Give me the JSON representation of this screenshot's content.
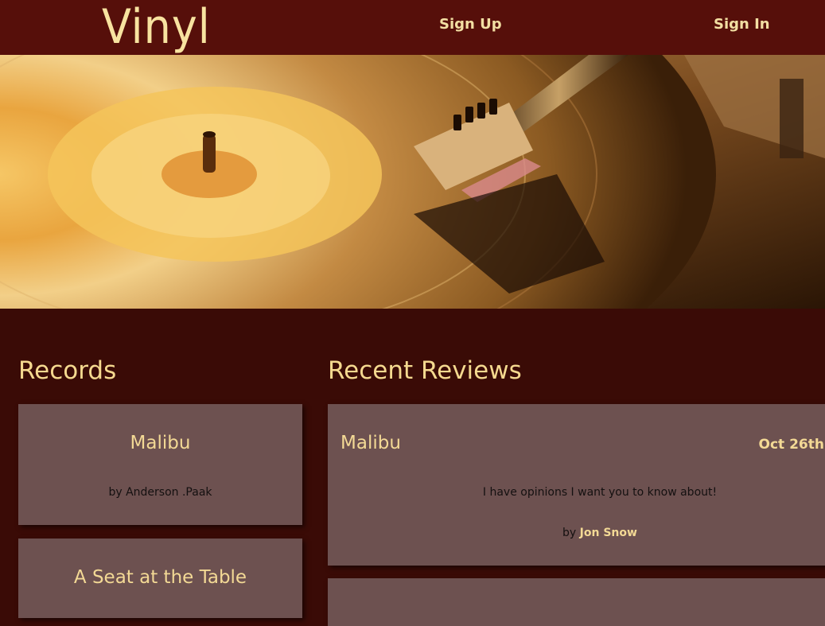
{
  "nav": {
    "logo": "Vinyl",
    "signup": "Sign Up",
    "signin": "Sign In"
  },
  "sections": {
    "records": "Records",
    "reviews": "Recent Reviews"
  },
  "records": [
    {
      "title": "Malibu",
      "artist": "by Anderson .Paak"
    },
    {
      "title": "A Seat at the Table",
      "artist": ""
    }
  ],
  "reviews": [
    {
      "title": "Malibu",
      "date": "Oct 26th",
      "body": "I have opinions I want you to know about!",
      "by": "by",
      "author": "Jon Snow"
    }
  ],
  "colors": {
    "navbar": "#560f0a",
    "background": "#3a0b06",
    "card": "#6d5150",
    "accent": "#f3d995"
  }
}
